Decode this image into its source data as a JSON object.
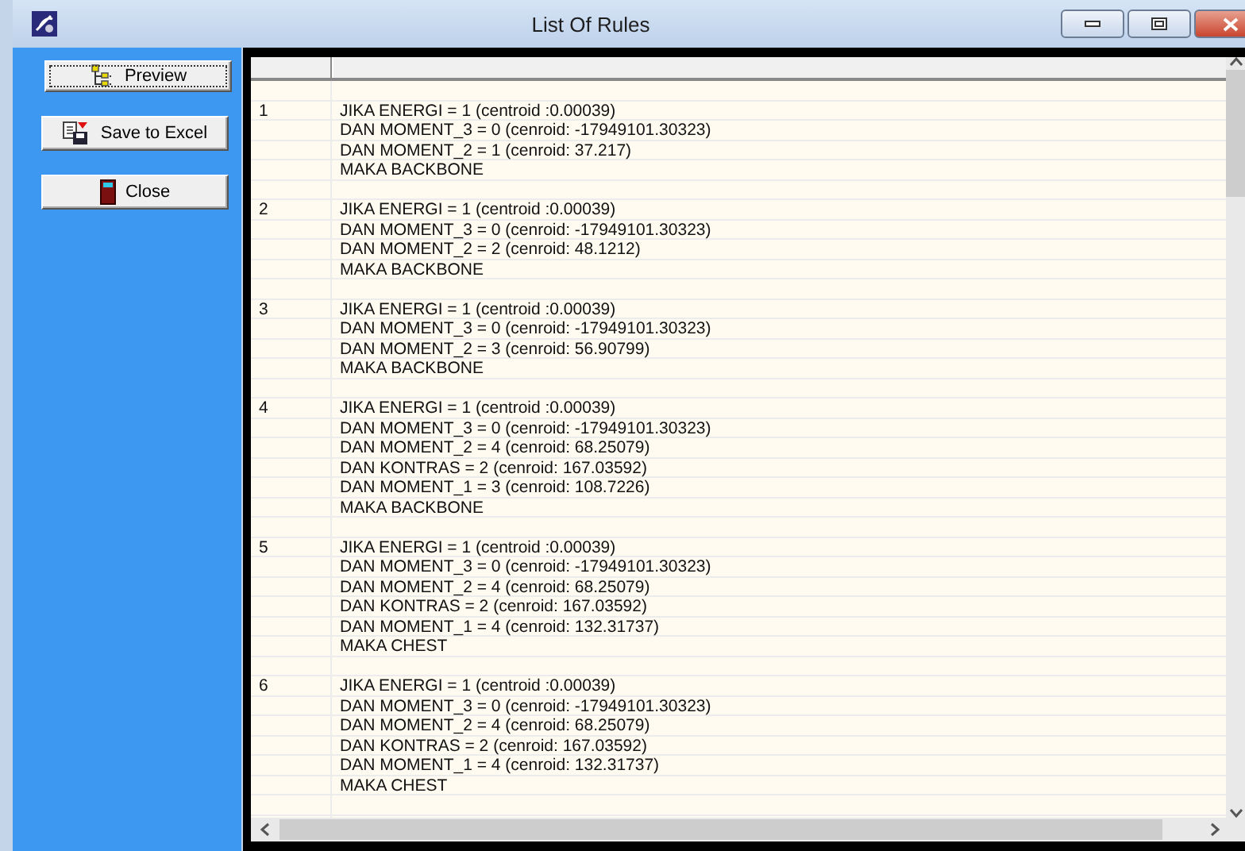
{
  "window": {
    "title": "List Of Rules"
  },
  "buttons": [
    {
      "label": "Preview",
      "focused": true
    },
    {
      "label": "Save to Excel",
      "focused": false
    },
    {
      "label": "Close",
      "focused": false
    }
  ],
  "rules": [
    {
      "number": "1",
      "lines": [
        "JIKA ENERGI = 1 (centroid :0.00039)",
        "DAN MOMENT_3 = 0 (cenroid: -17949101.30323)",
        "DAN MOMENT_2 = 1 (cenroid: 37.217)",
        "MAKA BACKBONE"
      ]
    },
    {
      "number": "2",
      "lines": [
        "JIKA ENERGI = 1 (centroid :0.00039)",
        "DAN MOMENT_3 = 0 (cenroid: -17949101.30323)",
        "DAN MOMENT_2 = 2 (cenroid: 48.1212)",
        "MAKA BACKBONE"
      ]
    },
    {
      "number": "3",
      "lines": [
        "JIKA ENERGI = 1 (centroid :0.00039)",
        "DAN MOMENT_3 = 0 (cenroid: -17949101.30323)",
        "DAN MOMENT_2 = 3 (cenroid: 56.90799)",
        "MAKA BACKBONE"
      ]
    },
    {
      "number": "4",
      "lines": [
        "JIKA ENERGI = 1 (centroid :0.00039)",
        "DAN MOMENT_3 = 0 (cenroid: -17949101.30323)",
        "DAN MOMENT_2 = 4 (cenroid: 68.25079)",
        "DAN KONTRAS = 2 (cenroid: 167.03592)",
        "DAN MOMENT_1 = 3 (cenroid: 108.7226)",
        "MAKA BACKBONE"
      ]
    },
    {
      "number": "5",
      "lines": [
        "JIKA ENERGI = 1 (centroid :0.00039)",
        "DAN MOMENT_3 = 0 (cenroid: -17949101.30323)",
        "DAN MOMENT_2 = 4 (cenroid: 68.25079)",
        "DAN KONTRAS = 2 (cenroid: 167.03592)",
        "DAN MOMENT_1 = 4 (cenroid: 132.31737)",
        "MAKA CHEST"
      ]
    },
    {
      "number": "6",
      "lines": [
        "JIKA ENERGI = 1 (centroid :0.00039)",
        "DAN MOMENT_3 = 0 (cenroid: -17949101.30323)",
        "DAN MOMENT_2 = 4 (cenroid: 68.25079)",
        "DAN KONTRAS = 2 (cenroid: 167.03592)",
        "DAN MOMENT_1 = 4 (cenroid: 132.31737)",
        "MAKA CHEST"
      ]
    }
  ]
}
